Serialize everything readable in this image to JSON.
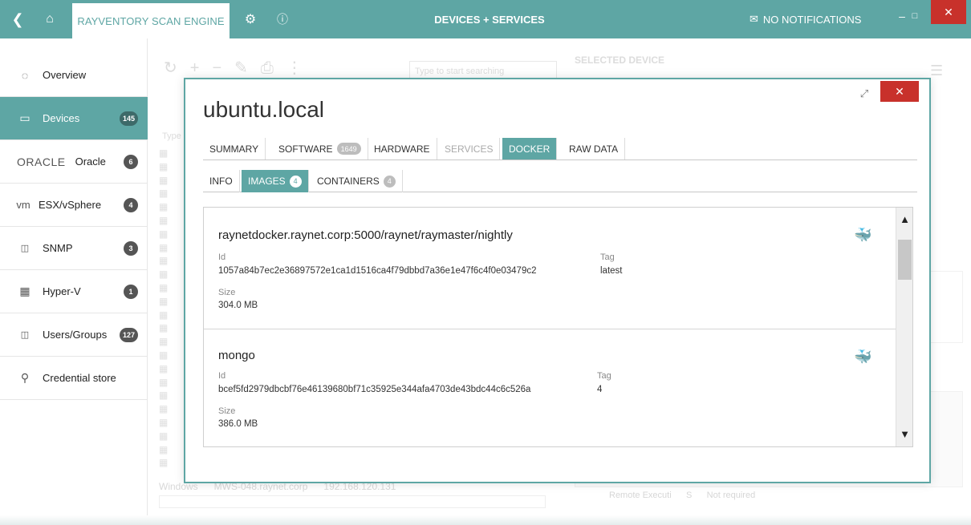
{
  "titlebar": {
    "back_icon": "chevron-left",
    "home_icon": "home",
    "app_tab": "RAYVENTORY SCAN ENGINE",
    "settings_icon": "gear",
    "info_icon": "info",
    "title": "DEVICES + SERVICES",
    "notifications": "NO NOTIFICATIONS",
    "close": "✕"
  },
  "sidebar": {
    "items": [
      {
        "label": "Overview",
        "icon": "overview-icon",
        "badge": ""
      },
      {
        "label": "Devices",
        "icon": "monitor-icon",
        "badge": "145"
      },
      {
        "label": "Oracle",
        "icon": "oracle-logo",
        "logo_text": "ORACLE",
        "badge": "6"
      },
      {
        "label": "ESX/vSphere",
        "icon": "vm-logo",
        "logo_text": "vm",
        "badge": "4"
      },
      {
        "label": "SNMP",
        "icon": "network-icon",
        "badge": "3"
      },
      {
        "label": "Hyper-V",
        "icon": "windows-icon",
        "badge": "1"
      },
      {
        "label": "Users/Groups",
        "icon": "network-icon",
        "badge": "127"
      },
      {
        "label": "Credential store",
        "icon": "key-icon",
        "badge": ""
      }
    ]
  },
  "background": {
    "search_placeholder": "Type to start searching",
    "selected_device": "SELECTED DEVICE",
    "type_header": "Type",
    "last_row": "Windows      MWS-048.raynet.corp      192.168.120.131",
    "bottom_text": "Remote Executi      S      Not required"
  },
  "dialog": {
    "title": "ubuntu.local",
    "close": "✕",
    "tabs": [
      {
        "label": "SUMMARY",
        "badge": ""
      },
      {
        "label": "SOFTWARE",
        "badge": "1649"
      },
      {
        "label": "HARDWARE",
        "badge": ""
      },
      {
        "label": "SERVICES",
        "badge": ""
      },
      {
        "label": "DOCKER",
        "badge": ""
      },
      {
        "label": "RAW DATA",
        "badge": ""
      }
    ],
    "active_tab": "DOCKER",
    "subtabs": [
      {
        "label": "INFO",
        "badge": ""
      },
      {
        "label": "IMAGES",
        "badge": "4"
      },
      {
        "label": "CONTAINERS",
        "badge": "4"
      }
    ],
    "active_subtab": "IMAGES",
    "images": [
      {
        "name": "raynetdocker.raynet.corp:5000/raynet/raymaster/nightly",
        "id_label": "Id",
        "id": "1057a84b7ec2e36897572e1ca1d1516ca4f79dbbd7a36e1e47f6c4f0e03479c2",
        "tag_label": "Tag",
        "tag": "latest",
        "size_label": "Size",
        "size": "304.0 MB"
      },
      {
        "name": "mongo",
        "id_label": "Id",
        "id": "bcef5fd2979dbcbf76e46139680bf71c35925e344afa4703de43bdc44c6c526a",
        "tag_label": "Tag",
        "tag": "4",
        "size_label": "Size",
        "size": "386.0 MB"
      }
    ]
  },
  "colors": {
    "accent": "#5ea6a4",
    "close": "#c8312b"
  }
}
